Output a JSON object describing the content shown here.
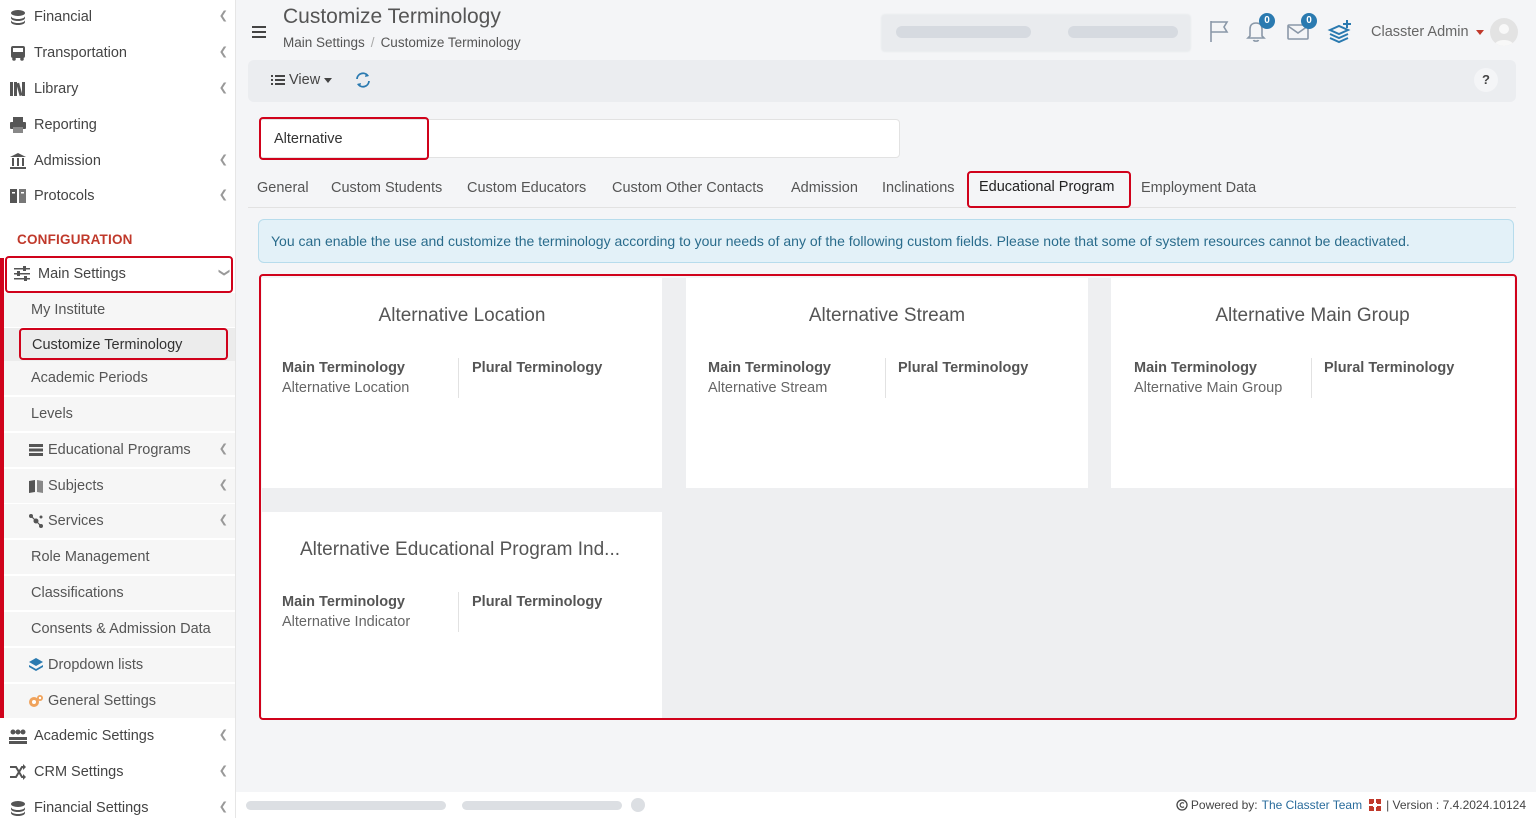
{
  "sidebar": {
    "top_items": [
      {
        "label": "Financial",
        "icon": "coins-icon"
      },
      {
        "label": "Transportation",
        "icon": "bus-icon"
      },
      {
        "label": "Library",
        "icon": "books-icon"
      },
      {
        "label": "Reporting",
        "icon": "printer-icon"
      },
      {
        "label": "Admission",
        "icon": "building-icon"
      },
      {
        "label": "Protocols",
        "icon": "archive-icon"
      }
    ],
    "section_label": "CONFIGURATION",
    "main_settings": "Main Settings",
    "sub_items": [
      {
        "label": "My Institute"
      },
      {
        "label": "Customize Terminology"
      },
      {
        "label": "Academic Periods"
      },
      {
        "label": "Levels"
      },
      {
        "label": "Educational Programs",
        "icon": "list-icon"
      },
      {
        "label": "Subjects",
        "icon": "book-icon"
      },
      {
        "label": "Services",
        "icon": "network-icon"
      },
      {
        "label": "Role Management"
      },
      {
        "label": "Classifications"
      },
      {
        "label": "Consents & Admission Data"
      },
      {
        "label": "Dropdown lists",
        "icon": "layers-icon"
      },
      {
        "label": "General Settings",
        "icon": "cogs-icon"
      }
    ],
    "bottom_items": [
      {
        "label": "Academic Settings",
        "icon": "users-icon"
      },
      {
        "label": "CRM Settings",
        "icon": "shuffle-icon"
      },
      {
        "label": "Financial Settings",
        "icon": "coins-icon"
      }
    ]
  },
  "header": {
    "title": "Customize Terminology",
    "breadcrumb": [
      "Main Settings",
      "Customize Terminology"
    ],
    "notifications_count": "0",
    "messages_count": "0",
    "user": "Classter Admin"
  },
  "toolbar": {
    "view_label": "View",
    "help_label": "?"
  },
  "search": {
    "value": "Alternative"
  },
  "tabs": [
    "General",
    "Custom Students",
    "Custom Educators",
    "Custom Other Contacts",
    "Admission",
    "Inclinations",
    "Educational Program",
    "Employment Data"
  ],
  "active_tab": "Educational Program",
  "alert": "You can enable the use and customize the terminology according to your needs of any of the following custom fields. Please note that some of system resources cannot be deactivated.",
  "cards": [
    {
      "title": "Alternative Location",
      "main_label": "Main Terminology",
      "main_value": "Alternative Location",
      "plural_label": "Plural Terminology",
      "plural_value": ""
    },
    {
      "title": "Alternative Stream",
      "main_label": "Main Terminology",
      "main_value": "Alternative Stream",
      "plural_label": "Plural Terminology",
      "plural_value": ""
    },
    {
      "title": "Alternative Main Group",
      "main_label": "Main Terminology",
      "main_value": "Alternative Main Group",
      "plural_label": "Plural Terminology",
      "plural_value": ""
    },
    {
      "title": "Alternative Educational Program Ind...",
      "main_label": "Main Terminology",
      "main_value": "Alternative Indicator",
      "plural_label": "Plural Terminology",
      "plural_value": ""
    }
  ],
  "footer": {
    "powered_by": "Powered by:",
    "team": "The Classter Team",
    "version": "| Version : 7.4.2024.10124"
  },
  "colors": {
    "accent_red": "#d0021b",
    "link_blue": "#2a6c9c",
    "badge_blue": "#2a7ab0",
    "alert_bg": "#e3f1f8"
  }
}
